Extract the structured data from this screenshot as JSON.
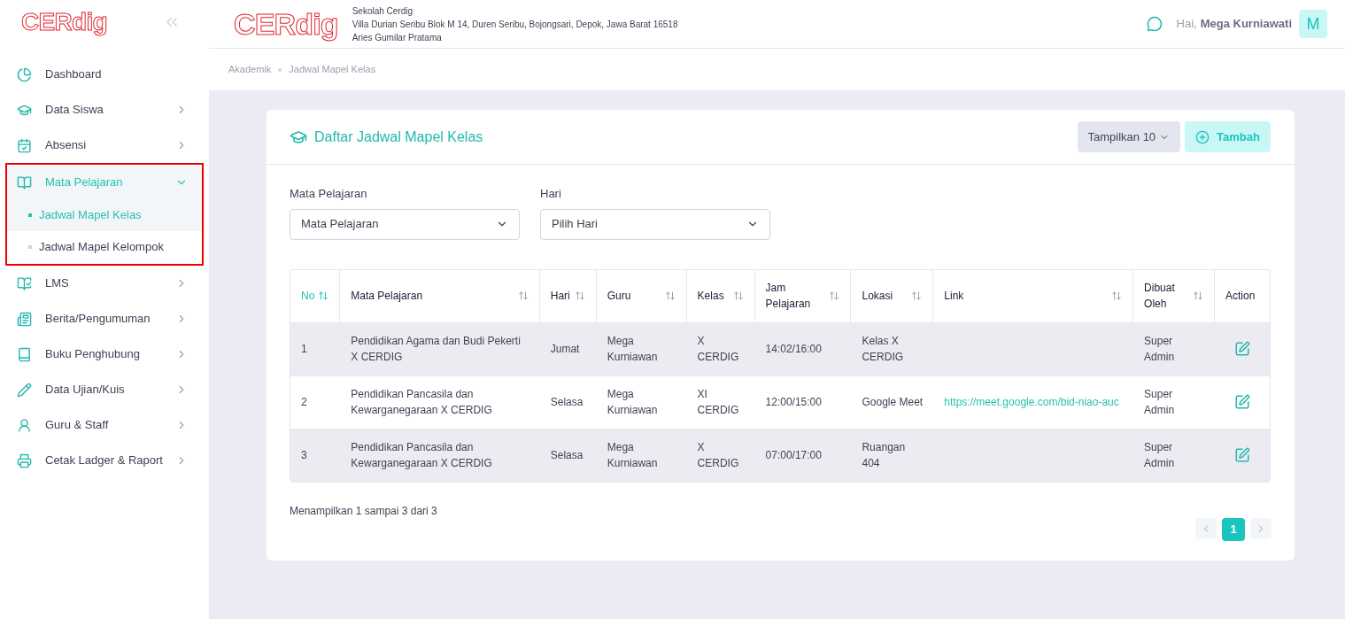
{
  "sidebar": {
    "logo": "CERdig",
    "items": [
      {
        "label": "Dashboard",
        "kind": "link",
        "expanded": false,
        "highlighted": false
      },
      {
        "label": "Data Siswa",
        "kind": "group",
        "expanded": false,
        "highlighted": false
      },
      {
        "label": "Absensi",
        "kind": "group",
        "expanded": false,
        "highlighted": false
      },
      {
        "label": "Mata Pelajaran",
        "kind": "group",
        "expanded": true,
        "highlighted": true,
        "children": [
          {
            "label": "Jadwal Mapel Kelas",
            "selected": true
          },
          {
            "label": "Jadwal Mapel Kelompok",
            "selected": false
          }
        ]
      },
      {
        "label": "LMS",
        "kind": "group",
        "expanded": false,
        "highlighted": false
      },
      {
        "label": "Berita/Pengumuman",
        "kind": "group",
        "expanded": false,
        "highlighted": false
      },
      {
        "label": "Buku Penghubung",
        "kind": "group",
        "expanded": false,
        "highlighted": false
      },
      {
        "label": "Data Ujian/Kuis",
        "kind": "group",
        "expanded": false,
        "highlighted": false
      },
      {
        "label": "Guru & Staff",
        "kind": "group",
        "expanded": false,
        "highlighted": false
      },
      {
        "label": "Cetak Ladger & Raport",
        "kind": "group",
        "expanded": false,
        "highlighted": false
      }
    ]
  },
  "header": {
    "logo": "CERdig",
    "school": "Sekolah Cerdig",
    "address": "Villa Durian Seribu Blok M 14, Duren Seribu, Bojongsari, Depok, Jawa Barat 16518",
    "principal": "Aries Gumilar Pratama",
    "greeting": "Hai,",
    "user": "Mega Kurniawati",
    "avatar": "M"
  },
  "breadcrumb": [
    "Akademik",
    "Jadwal Mapel Kelas"
  ],
  "card": {
    "title": "Daftar Jadwal Mapel Kelas",
    "page_size": "Tampilkan 10",
    "add_button": "Tambah"
  },
  "filters": [
    {
      "label": "Mata Pelajaran",
      "value": "Mata Pelajaran"
    },
    {
      "label": "Hari",
      "value": "Pilih Hari"
    }
  ],
  "table": {
    "columns": [
      {
        "label": "No",
        "sortable": true,
        "active": true
      },
      {
        "label": "Mata Pelajaran",
        "sortable": true,
        "active": false
      },
      {
        "label": "Hari",
        "sortable": true,
        "active": false
      },
      {
        "label": "Guru",
        "sortable": true,
        "active": false
      },
      {
        "label": "Kelas",
        "sortable": true,
        "active": false
      },
      {
        "label": "Jam Pelajaran",
        "sortable": true,
        "active": false
      },
      {
        "label": "Lokasi",
        "sortable": true,
        "active": false
      },
      {
        "label": "Link",
        "sortable": true,
        "active": false
      },
      {
        "label": "Dibuat Oleh",
        "sortable": true,
        "active": false
      },
      {
        "label": "Action",
        "sortable": false,
        "active": false
      }
    ],
    "rows": [
      {
        "no": "1",
        "subject": "Pendidikan Agama dan Budi Pekerti X CERDIG",
        "day": "Jumat",
        "teacher": "Mega Kurniawan",
        "class": "X CERDIG",
        "time": "14:02/16:00",
        "location": "Kelas X CERDIG",
        "link": "",
        "created_by": "Super Admin"
      },
      {
        "no": "2",
        "subject": "Pendidikan Pancasila dan Kewarganegaraan X CERDIG",
        "day": "Selasa",
        "teacher": "Mega Kurniawan",
        "class": "XI CERDIG",
        "time": "12:00/15:00",
        "location": "Google Meet",
        "link": "https://meet.google.com/bid-niao-auc",
        "created_by": "Super Admin"
      },
      {
        "no": "3",
        "subject": "Pendidikan Pancasila dan Kewarganegaraan X CERDIG",
        "day": "Selasa",
        "teacher": "Mega Kurniawan",
        "class": "X CERDIG",
        "time": "07:00/17:00",
        "location": "Ruangan 404",
        "link": "",
        "created_by": "Super Admin"
      }
    ]
  },
  "summary": "Menampilkan 1 sampai 3 dari 3",
  "pagination": {
    "pages": [
      {
        "label": "1",
        "selected": true
      }
    ]
  }
}
